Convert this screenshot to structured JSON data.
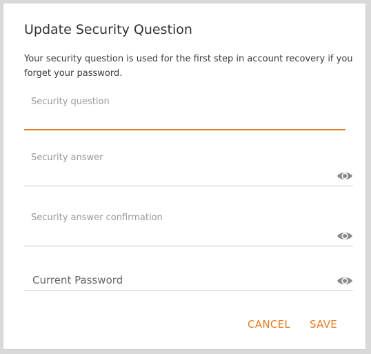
{
  "dialog": {
    "title": "Update Security Question",
    "description": "Your security question is used for the first step in account recovery if you forget your password."
  },
  "fields": {
    "security_question": {
      "label": "Security question",
      "value": ""
    },
    "security_answer": {
      "label": "Security answer",
      "value": ""
    },
    "security_answer_confirmation": {
      "label": "Security answer confirmation",
      "value": ""
    },
    "current_password": {
      "label": "Current Password",
      "value": ""
    }
  },
  "actions": {
    "cancel_label": "CANCEL",
    "save_label": "SAVE"
  },
  "icons": {
    "show_password": "eye-icon"
  },
  "colors": {
    "accent": "#e67e22",
    "underline": "#c8c8c8",
    "label": "#9a9a9a"
  }
}
